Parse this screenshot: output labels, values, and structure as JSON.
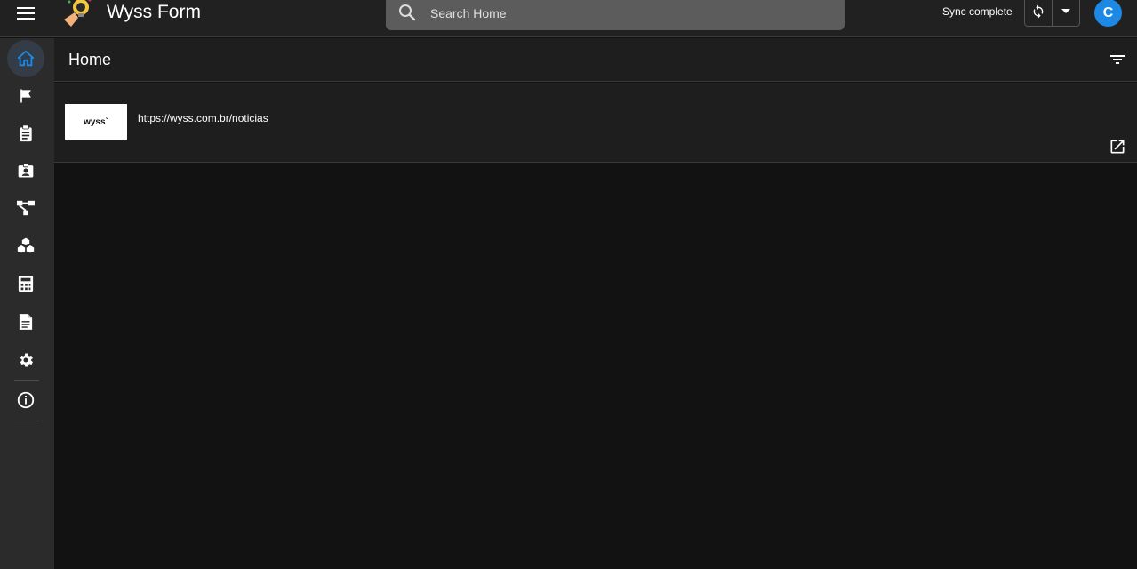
{
  "app": {
    "title": "Wyss Form"
  },
  "search": {
    "placeholder": "Search Home"
  },
  "sync": {
    "status": "Sync complete"
  },
  "user": {
    "initial": "C"
  },
  "colors": {
    "accent": "#1e88e5",
    "active_nav": "#1e88e5"
  },
  "sidebar": {
    "items": [
      {
        "icon": "home-icon",
        "active": true
      },
      {
        "icon": "flag-icon"
      },
      {
        "icon": "clipboard-icon"
      },
      {
        "icon": "badge-icon"
      },
      {
        "icon": "workflow-icon"
      },
      {
        "icon": "cubes-icon"
      },
      {
        "icon": "calculator-icon"
      },
      {
        "icon": "document-icon"
      },
      {
        "icon": "gear-icon"
      },
      {
        "icon": "info-icon"
      }
    ]
  },
  "main": {
    "title": "Home",
    "items": [
      {
        "thumb_text": "wyss`",
        "url": "https://wyss.com.br/noticias"
      }
    ]
  }
}
